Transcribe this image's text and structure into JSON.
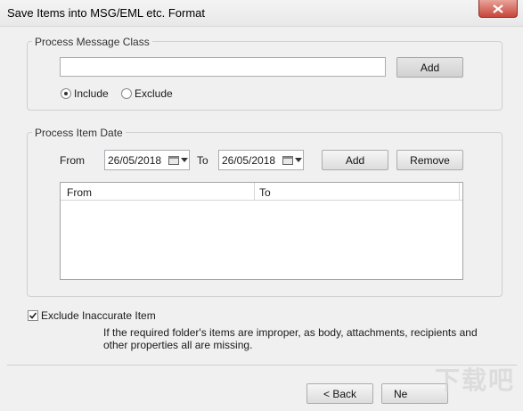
{
  "window": {
    "title": "Save Items into MSG/EML etc. Format"
  },
  "message_class": {
    "legend": "Process Message Class",
    "input_value": "",
    "add_label": "Add",
    "include_label": "Include",
    "exclude_label": "Exclude",
    "selected": "Include"
  },
  "item_date": {
    "legend": "Process Item Date",
    "from_label": "From",
    "to_label": "To",
    "from_value": "26/05/2018",
    "to_value": "26/05/2018",
    "add_label": "Add",
    "remove_label": "Remove",
    "columns": [
      "From",
      "To"
    ]
  },
  "exclude_inaccurate": {
    "label": "Exclude Inaccurate Item",
    "checked": true,
    "description": "If the required folder's items are improper, as body, attachments, recipients and other properties all are missing."
  },
  "footer": {
    "back_label": "< Back",
    "next_label": "Ne"
  },
  "watermark": {
    "text": "下载吧"
  },
  "colors": {
    "close_button": "#c8453a",
    "group_border": "#cfcfcf",
    "button_gray": "#dcdcdc"
  }
}
